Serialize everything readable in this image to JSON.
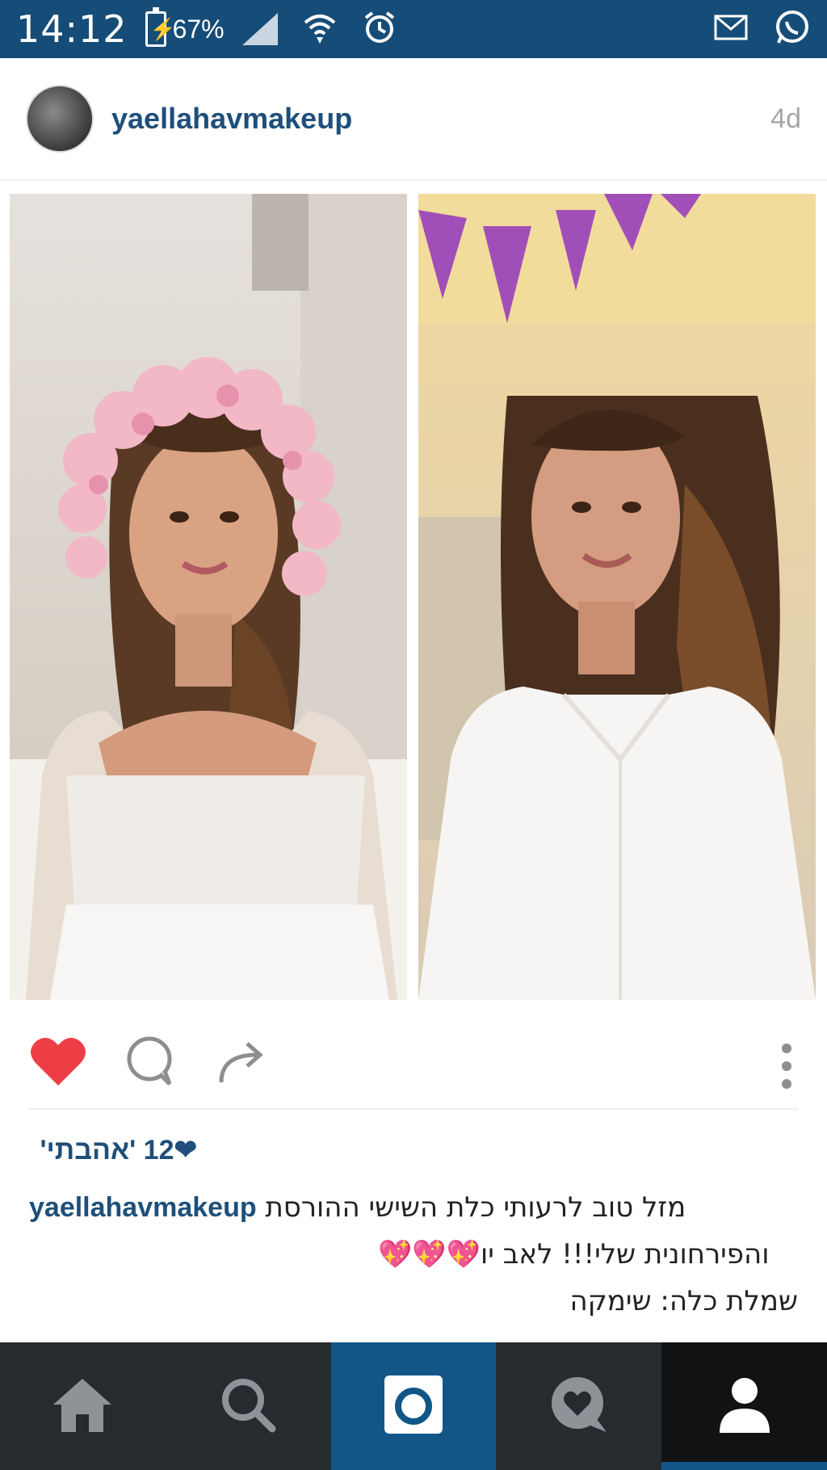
{
  "status_bar": {
    "time": "14:12",
    "battery_percent": "67%",
    "battery_glyph": "⚡"
  },
  "post": {
    "username": "yaellahavmakeup",
    "time_ago": "4d",
    "liked": true,
    "likes_text": "12 'אהבתי'",
    "caption_user": "yaellahavmakeup",
    "caption_line1": "מזל טוב לרעותי כלת השישי ההורסת",
    "caption_line2": "והפירחונית שלי!!! לאב יו",
    "caption_hearts": "💖💖💖",
    "caption_line3": "שמלת כלה: שימקה"
  },
  "colors": {
    "status_bar": "#154d78",
    "username": "#1f4f7a",
    "like_heart": "#ed3e45",
    "nav_bg": "#262b30",
    "nav_active": "#125688"
  },
  "icons": {
    "like": "heart-icon",
    "comment": "comment-icon",
    "share": "share-arrow-icon",
    "more": "more-vertical-icon",
    "nav": [
      "home-icon",
      "search-icon",
      "camera-icon",
      "activity-heart-icon",
      "profile-icon"
    ]
  }
}
